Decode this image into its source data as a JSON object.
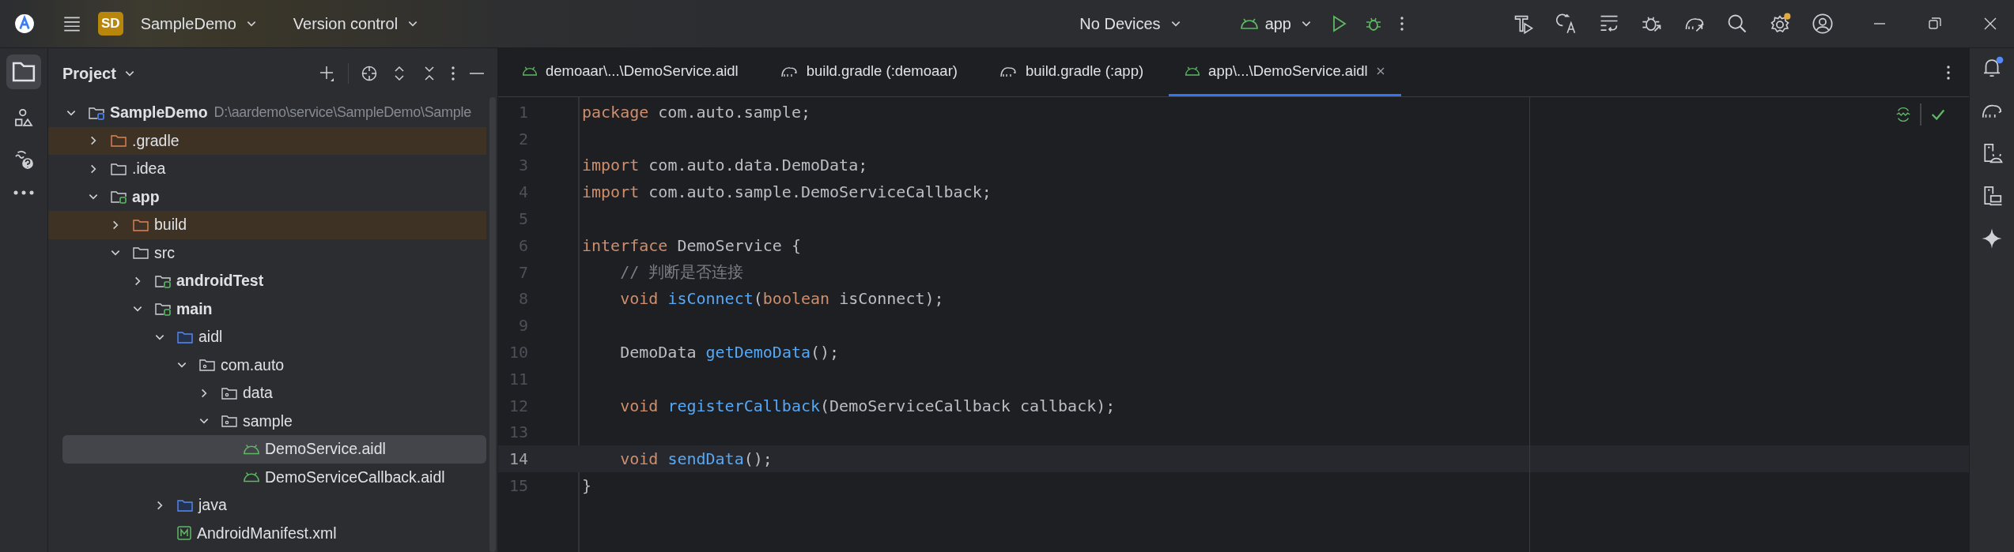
{
  "topbar": {
    "project_badge": "SD",
    "project": "SampleDemo",
    "vcs": "Version control",
    "device": "No Devices",
    "run_config": "app"
  },
  "panel": {
    "title": "Project",
    "tree": [
      {
        "name": "SampleDemo",
        "kind": "project",
        "path": "D:\\aardemo\\service\\SampleDemo\\Sample",
        "expanded": true,
        "selected": false,
        "children": [
          {
            "name": ".gradle",
            "kind": "excluded",
            "expanded": false,
            "selected": false
          },
          {
            "name": ".idea",
            "kind": "folder",
            "expanded": false,
            "selected": false
          },
          {
            "name": "app",
            "kind": "module",
            "expanded": true,
            "selected": false,
            "children": [
              {
                "name": "build",
                "kind": "excluded",
                "expanded": false,
                "selected": false
              },
              {
                "name": "src",
                "kind": "folder",
                "expanded": true,
                "selected": false,
                "children": [
                  {
                    "name": "androidTest",
                    "kind": "module",
                    "expanded": false,
                    "selected": false
                  },
                  {
                    "name": "main",
                    "kind": "module",
                    "expanded": true,
                    "selected": false,
                    "children": [
                      {
                        "name": "aidl",
                        "kind": "source",
                        "expanded": true,
                        "selected": false,
                        "children": [
                          {
                            "name": "com.auto",
                            "kind": "package",
                            "expanded": true,
                            "selected": false,
                            "children": [
                              {
                                "name": "data",
                                "kind": "package",
                                "expanded": false,
                                "selected": false
                              },
                              {
                                "name": "sample",
                                "kind": "package",
                                "expanded": true,
                                "selected": false,
                                "children": [
                                  {
                                    "name": "DemoService.aidl",
                                    "kind": "aidl",
                                    "selected": true
                                  },
                                  {
                                    "name": "DemoServiceCallback.aidl",
                                    "kind": "aidl",
                                    "selected": false
                                  }
                                ]
                              }
                            ]
                          }
                        ]
                      },
                      {
                        "name": "java",
                        "kind": "source",
                        "expanded": false,
                        "selected": false
                      },
                      {
                        "name": "AndroidManifest.xml",
                        "kind": "manifest",
                        "selected": false
                      }
                    ]
                  }
                ]
              }
            ]
          }
        ]
      }
    ]
  },
  "tabs": [
    {
      "label": "demoaar\\...\\DemoService.aidl",
      "kind": "aidl",
      "selected": false
    },
    {
      "label": "build.gradle (:demoaar)",
      "kind": "gradle",
      "selected": false
    },
    {
      "label": "build.gradle (:app)",
      "kind": "gradle",
      "selected": false
    },
    {
      "label": "app\\...\\DemoService.aidl",
      "kind": "aidl",
      "selected": true
    }
  ],
  "editor": {
    "lines": [
      {
        "number": "1",
        "selected": false,
        "tokens": [
          {
            "text": "package ",
            "kind": "keyword"
          },
          {
            "text": "com.auto.sample;",
            "kind": "plain"
          }
        ]
      },
      {
        "number": "2",
        "selected": false
      },
      {
        "number": "3",
        "selected": false,
        "tokens": [
          {
            "text": "import ",
            "kind": "keyword"
          },
          {
            "text": "com.auto.data.DemoData;",
            "kind": "plain"
          }
        ]
      },
      {
        "number": "4",
        "selected": false,
        "tokens": [
          {
            "text": "import ",
            "kind": "keyword"
          },
          {
            "text": "com.auto.sample.DemoServiceCallback;",
            "kind": "plain"
          }
        ]
      },
      {
        "number": "5",
        "selected": false
      },
      {
        "number": "6",
        "selected": false,
        "tokens": [
          {
            "text": "interface ",
            "kind": "keyword"
          },
          {
            "text": "DemoService {",
            "kind": "plain"
          }
        ]
      },
      {
        "number": "7",
        "selected": false,
        "tokens": [
          {
            "text": "    // 判断是否连接",
            "kind": "comment"
          }
        ]
      },
      {
        "number": "8",
        "selected": false,
        "tokens": [
          {
            "text": "    void ",
            "kind": "keyword"
          },
          {
            "text": "isConnect",
            "kind": "function"
          },
          {
            "text": "(",
            "kind": "plain"
          },
          {
            "text": "boolean ",
            "kind": "keyword"
          },
          {
            "text": "isConnect);",
            "kind": "plain"
          }
        ]
      },
      {
        "number": "9",
        "selected": false
      },
      {
        "number": "10",
        "selected": false,
        "tokens": [
          {
            "text": "    DemoData ",
            "kind": "plain"
          },
          {
            "text": "getDemoData",
            "kind": "function"
          },
          {
            "text": "();",
            "kind": "plain"
          }
        ]
      },
      {
        "number": "11",
        "selected": false
      },
      {
        "number": "12",
        "selected": false,
        "tokens": [
          {
            "text": "    void ",
            "kind": "keyword"
          },
          {
            "text": "registerCallback",
            "kind": "function"
          },
          {
            "text": "(DemoServiceCallback callback);",
            "kind": "plain"
          }
        ]
      },
      {
        "number": "13",
        "selected": false
      },
      {
        "number": "14",
        "selected": true,
        "tokens": [
          {
            "text": "    void ",
            "kind": "keyword"
          },
          {
            "text": "sendData",
            "kind": "function"
          },
          {
            "text": "();",
            "kind": "plain"
          }
        ]
      },
      {
        "number": "15",
        "selected": false,
        "tokens": [
          {
            "text": "}",
            "kind": "plain"
          }
        ]
      }
    ]
  }
}
